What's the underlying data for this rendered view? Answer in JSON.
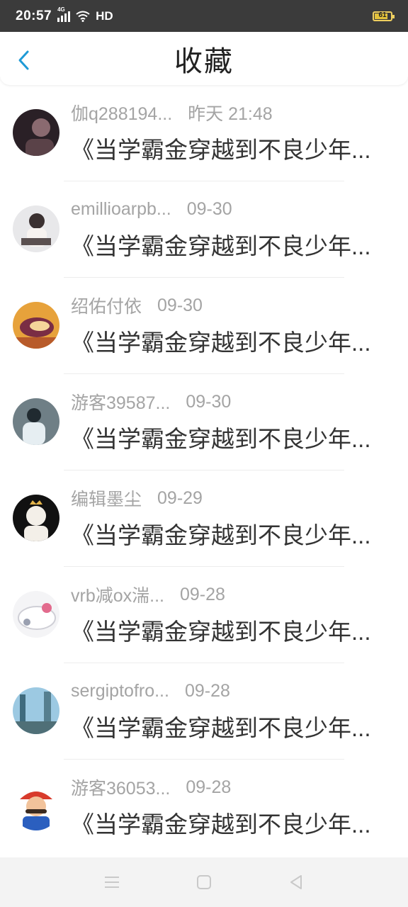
{
  "status_bar": {
    "time": "20:57",
    "network": "4G",
    "hd": "HD",
    "battery_level": "61"
  },
  "header": {
    "back_icon": "back-chevron-icon",
    "title": "收藏"
  },
  "items": [
    {
      "username": "伽q288194...",
      "time": "昨天 21:48",
      "title": "《当学霸金穿越到不良少年...",
      "avatar_colors": [
        "#2a2026",
        "#8a6a70"
      ]
    },
    {
      "username": "emillioarpb...",
      "time": "09-30",
      "title": "《当学霸金穿越到不良少年...",
      "avatar_colors": [
        "#e8e8ea",
        "#5a5050"
      ]
    },
    {
      "username": "绍佑付依",
      "time": "09-30",
      "title": "《当学霸金穿越到不良少年...",
      "avatar_colors": [
        "#e7a23b",
        "#7a2d44"
      ]
    },
    {
      "username": "游客39587...",
      "time": "09-30",
      "title": "《当学霸金穿越到不良少年...",
      "avatar_colors": [
        "#6f7f86",
        "#202a30"
      ]
    },
    {
      "username": "编辑墨尘",
      "time": "09-29",
      "title": "《当学霸金穿越到不良少年...",
      "avatar_colors": [
        "#111111",
        "#f3efe8"
      ]
    },
    {
      "username": "vrb减ox湍...",
      "time": "09-28",
      "title": "《当学霸金穿越到不良少年...",
      "avatar_colors": [
        "#f4f4f6",
        "#e26b8d"
      ]
    },
    {
      "username": "sergiptofro...",
      "time": "09-28",
      "title": "《当学霸金穿越到不良少年...",
      "avatar_colors": [
        "#9cc9e2",
        "#3f6b7e"
      ]
    },
    {
      "username": "游客36053...",
      "time": "09-28",
      "title": "《当学霸金穿越到不良少年...",
      "avatar_colors": [
        "#d83b2c",
        "#2b5fbf"
      ]
    }
  ],
  "nav_bar": {
    "menu_icon": "menu-icon",
    "home_icon": "home-square-icon",
    "back_icon": "back-triangle-icon"
  },
  "colors": {
    "accent": "#1e9ad6",
    "status_bar_bg": "#3b3b3b",
    "meta_text": "#a4a4a4",
    "title_text": "#333333"
  }
}
